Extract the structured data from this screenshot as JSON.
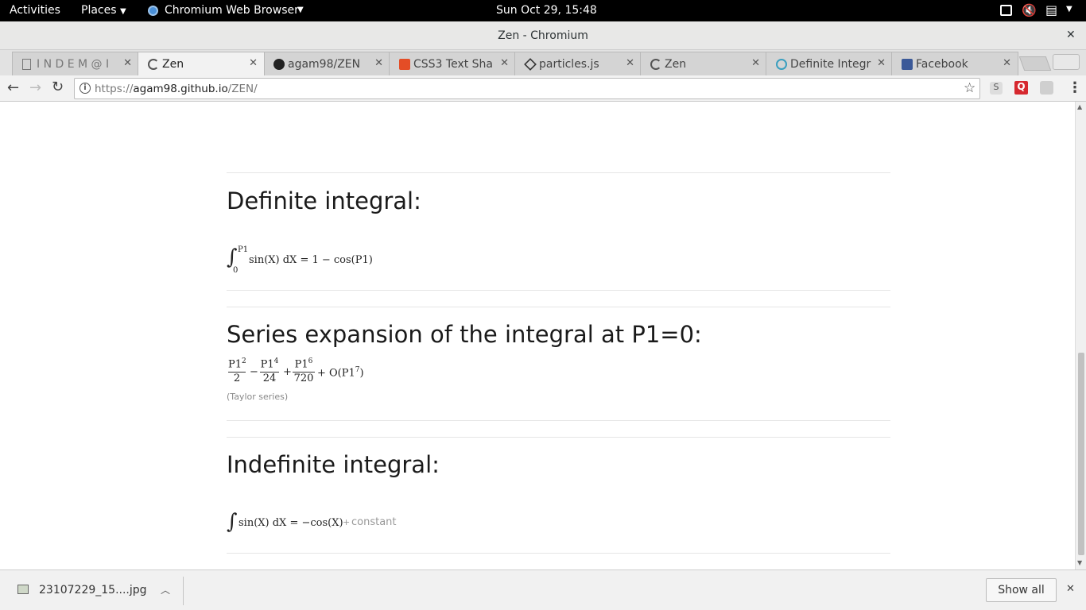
{
  "system_bar": {
    "activities": "Activities",
    "places": "Places",
    "browser_app": "Chromium Web Browser",
    "clock": "Sun Oct 29, 15:48"
  },
  "window": {
    "title": "Zen - Chromium",
    "close": "✕"
  },
  "tabs": [
    {
      "label": "I N D E M @ I",
      "icon": "page-icon",
      "active": false
    },
    {
      "label": "Zen",
      "icon": "loading-icon",
      "active": true
    },
    {
      "label": "agam98/ZEN",
      "icon": "github-icon",
      "active": false
    },
    {
      "label": "CSS3 Text Sha",
      "icon": "html5-icon",
      "active": false
    },
    {
      "label": "particles.js",
      "icon": "codepen-icon",
      "active": false
    },
    {
      "label": "Zen",
      "icon": "loading-icon",
      "active": false
    },
    {
      "label": "Definite Integr",
      "icon": "wolfram-icon",
      "active": false
    },
    {
      "label": "Facebook",
      "icon": "facebook-icon",
      "active": false
    }
  ],
  "address": {
    "url_prefix": "https://",
    "url_host": "agam98.github.io",
    "url_path": "/ZEN/"
  },
  "sections": {
    "definite": {
      "heading": "Definite integral:",
      "upper": "P1",
      "lower": "0",
      "integrand": "sin(X) dX = 1 − cos(P1)"
    },
    "series": {
      "heading": "Series expansion of the integral at P1=0:",
      "t1_num": "P1",
      "t1_exp": "2",
      "t1_den": "2",
      "op1": "−",
      "t2_num": "P1",
      "t2_exp": "4",
      "t2_den": "24",
      "op2": "+",
      "t3_num": "P1",
      "t3_exp": "6",
      "t3_den": "720",
      "tail": "+ O(P1",
      "tail_exp": "7",
      "tail_close": ")",
      "note": "(Taylor series)"
    },
    "indefinite": {
      "heading": "Indefinite integral:",
      "integrand": "sin(X) dX = −cos(X)",
      "plus": "+",
      "constant": "constant"
    }
  },
  "downloads": {
    "file_name": "23107229_15....jpg",
    "show_all": "Show all",
    "close": "✕"
  }
}
